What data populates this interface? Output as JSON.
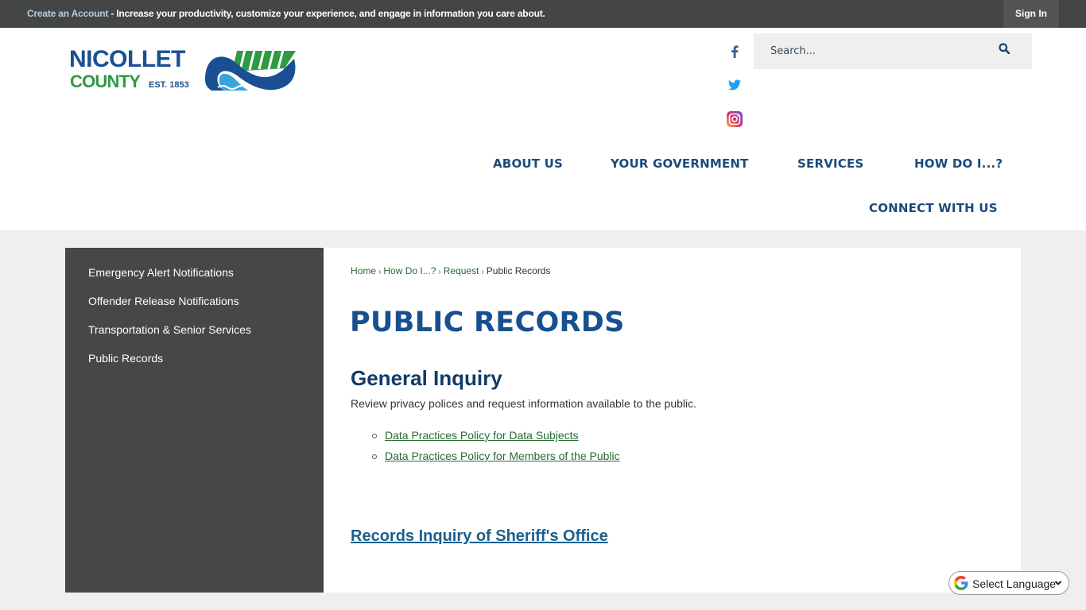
{
  "topbar": {
    "create_account_link": "Create an Account",
    "message": " - Increase your productivity, customize your experience, and engage in information you care about.",
    "sign_in": "Sign In"
  },
  "logo": {
    "line1": "NICOLLET",
    "line2": "COUNTY",
    "est": "EST. 1853",
    "colors": {
      "blue": "#1a4f93",
      "green": "#2e9b43",
      "water": "#3aa3dc"
    }
  },
  "social": [
    {
      "name": "facebook-icon",
      "color": "#3b5998"
    },
    {
      "name": "twitter-icon",
      "color": "#1da1f2"
    },
    {
      "name": "instagram-icon",
      "color": "#c13584"
    }
  ],
  "search": {
    "placeholder": "Search...",
    "icon": "search-icon"
  },
  "nav": {
    "items": [
      "ABOUT US",
      "YOUR GOVERNMENT",
      "SERVICES",
      "HOW DO I...?",
      "CONNECT WITH US"
    ]
  },
  "sidebar": {
    "items": [
      "Emergency Alert Notifications",
      "Offender Release Notifications",
      "Transportation & Senior Services",
      "Public Records"
    ]
  },
  "breadcrumb": {
    "items": [
      "Home",
      "How Do I...?",
      "Request"
    ],
    "current": "Public Records",
    "separator": "›"
  },
  "content": {
    "title": "PUBLIC RECORDS",
    "section_heading": "General Inquiry",
    "description": "Review privacy polices and request information available to the public.",
    "links": [
      "Data Practices Policy for Data Subjects",
      "Data Practices Policy for Members of the Public"
    ],
    "sheriff_link": "Records Inquiry of Sheriff's Office"
  },
  "language": {
    "label": "Select Language"
  }
}
